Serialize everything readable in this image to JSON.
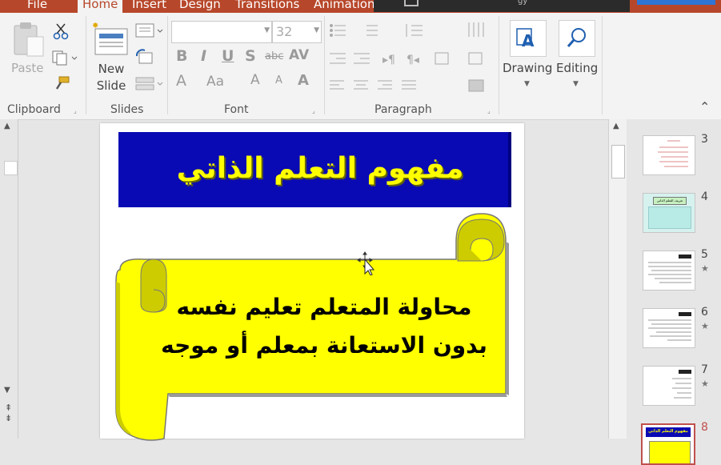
{
  "tabs": [
    "File",
    "Home",
    "Insert",
    "Design",
    "Transitions",
    "Animations"
  ],
  "active_tab": "Home",
  "tell_me_text": "gy",
  "ribbon": {
    "clipboard": {
      "label": "Clipboard",
      "paste_label": "Paste"
    },
    "slides": {
      "label": "Slides",
      "new_slide_label": "New\nSlide"
    },
    "font": {
      "label": "Font",
      "font_name": "",
      "font_size": "32"
    },
    "paragraph": {
      "label": "Paragraph"
    },
    "drawing": {
      "label": "Drawing"
    },
    "editing": {
      "label": "Editing"
    }
  },
  "slide": {
    "title": "مفهوم التعلم الذاتي",
    "body_line1": "محاولة المتعلم تعليم نفسه",
    "body_line2": "بدون الاستعانة بمعلم أو موجه"
  },
  "thumbnails": [
    {
      "number": "3",
      "star": false
    },
    {
      "number": "4",
      "star": false
    },
    {
      "number": "5",
      "star": true
    },
    {
      "number": "6",
      "star": true
    },
    {
      "number": "7",
      "star": true
    },
    {
      "number": "8",
      "star": false,
      "selected": true
    }
  ],
  "thumb_title_8": "مفهوم التعلم الذاتي",
  "thumb_title_4": "تعريف التعلم الذاتي",
  "colors": {
    "accent": "#b7472a",
    "title_band": "#0a0ab4",
    "title_text": "#ffff00",
    "scroll_fill": "#ffff00",
    "selected_border": "#c0504d"
  }
}
